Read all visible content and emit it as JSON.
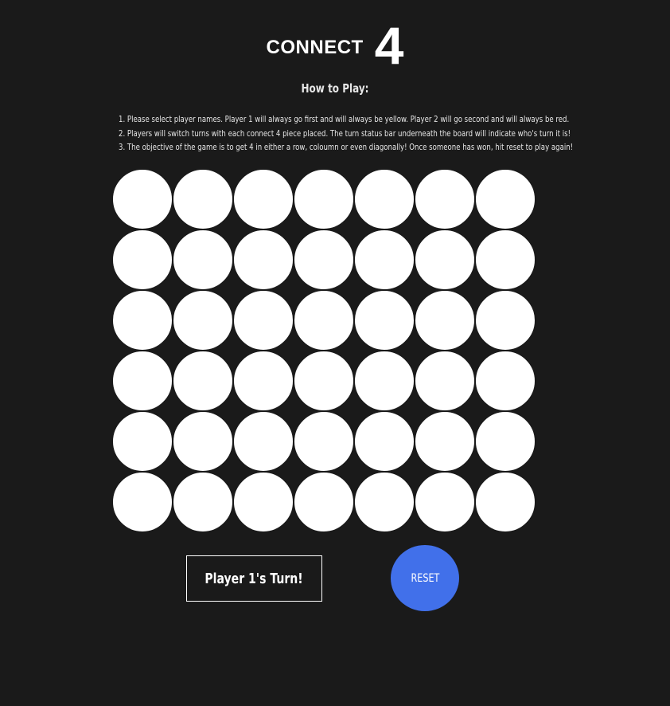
{
  "header": {
    "title_word": "CONNECT",
    "title_number": "4"
  },
  "how_to_play": {
    "heading": "How to Play:",
    "steps": [
      "1. Please select player names. Player 1 will always go first and will always be yellow. Player 2 will go second and will always be red.",
      "2. Players will switch turns with each connect 4 piece placed. The turn status bar underneath the board will indicate who's turn it is!",
      "3. The objective of the game is to get 4 in either a row, coloumn or even diagonally! Once someone has won, hit reset to play again!"
    ]
  },
  "board": {
    "rows": 6,
    "columns": 7,
    "empty_color": "#ffffff",
    "player1_color": "yellow",
    "player2_color": "red",
    "cells": [
      [
        "empty",
        "empty",
        "empty",
        "empty",
        "empty",
        "empty",
        "empty"
      ],
      [
        "empty",
        "empty",
        "empty",
        "empty",
        "empty",
        "empty",
        "empty"
      ],
      [
        "empty",
        "empty",
        "empty",
        "empty",
        "empty",
        "empty",
        "empty"
      ],
      [
        "empty",
        "empty",
        "empty",
        "empty",
        "empty",
        "empty",
        "empty"
      ],
      [
        "empty",
        "empty",
        "empty",
        "empty",
        "empty",
        "empty",
        "empty"
      ],
      [
        "empty",
        "empty",
        "empty",
        "empty",
        "empty",
        "empty",
        "empty"
      ]
    ]
  },
  "status": {
    "turn_label": "Player 1's Turn!"
  },
  "controls": {
    "reset_label": "RESET",
    "reset_color": "#4170ea"
  },
  "theme": {
    "background": "#1a1a1a",
    "text": "#ffffff"
  }
}
